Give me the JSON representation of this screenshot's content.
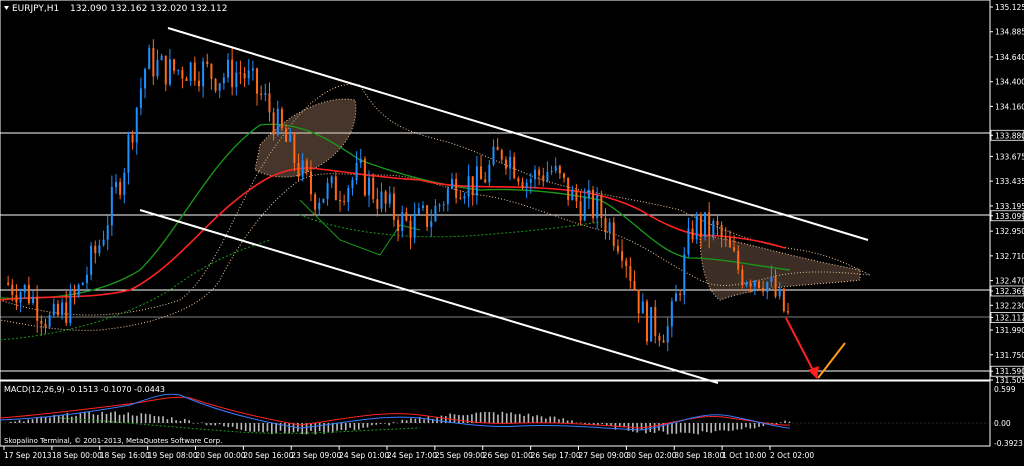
{
  "header": {
    "symbol": "EURJPY,H1",
    "ohlc": "132.090 132.162 132.020 132.112"
  },
  "price_axis": {
    "ticks": [
      "135.125",
      "134.885",
      "134.640",
      "134.400",
      "134.160",
      "133.880",
      "133.675",
      "133.435",
      "133.195",
      "133.099",
      "132.950",
      "132.710",
      "132.470",
      "132.369",
      "132.230",
      "132.112",
      "131.990",
      "131.750",
      "131.590",
      "131.505"
    ],
    "highlighted": [
      "133.880",
      "133.099",
      "132.369",
      "132.112",
      "131.590"
    ]
  },
  "macd": {
    "label": "MACD(12,26,9) -0.1513 -0.1070 -0.0443",
    "ticks": [
      "0.599",
      "0.00",
      "-0.3923"
    ]
  },
  "time_axis": {
    "labels": [
      "17 Sep 2013",
      "18 Sep 00:00",
      "18 Sep 16:00",
      "19 Sep 08:00",
      "20 Sep 00:00",
      "20 Sep 16:00",
      "23 Sep 09:00",
      "24 Sep 01:00",
      "24 Sep 17:00",
      "25 Sep 09:00",
      "26 Sep 01:00",
      "26 Sep 17:00",
      "27 Sep 09:00",
      "30 Sep 02:00",
      "30 Sep 18:00",
      "1 Oct 10:00",
      "2 Oct 02:00"
    ]
  },
  "footer": {
    "copyright": "Skopalino Terminal, © 2001-2013, MetaQuotes Software Corp."
  },
  "colors": {
    "background": "#000000",
    "candle_up": "#1e90ff",
    "candle_down": "#ff6a1a",
    "ma_red": "#ff2222",
    "ma_green": "#1a9a1a",
    "cloud": "#f5c8a0",
    "channel": "#ffffff",
    "arrow_down": "#ff2020",
    "arrow_up": "#ff9a20"
  },
  "chart_data": {
    "type": "candlestick",
    "ylim": [
      131.505,
      135.125
    ],
    "close_path": [
      [
        "17 Sep 2013",
        132.45
      ],
      [
        "18 Sep 00:00",
        132.36
      ],
      [
        "18 Sep 08:00",
        132.05
      ],
      [
        "18 Sep 16:00",
        132.3
      ],
      [
        "19 Sep 00:00",
        132.82
      ],
      [
        "19 Sep 04:00",
        133.55
      ],
      [
        "19 Sep 08:00",
        134.6
      ],
      [
        "19 Sep 16:00",
        134.5
      ],
      [
        "20 Sep 00:00",
        134.55
      ],
      [
        "20 Sep 08:00",
        134.45
      ],
      [
        "20 Sep 16:00",
        134.5
      ],
      [
        "21 Sep 00:00",
        134.2
      ],
      [
        "23 Sep 01:00",
        133.75
      ],
      [
        "23 Sep 09:00",
        133.3
      ],
      [
        "23 Sep 17:00",
        133.35
      ],
      [
        "24 Sep 01:00",
        133.5
      ],
      [
        "24 Sep 09:00",
        133.2
      ],
      [
        "24 Sep 17:00",
        133.0
      ],
      [
        "25 Sep 01:00",
        133.1
      ],
      [
        "25 Sep 09:00",
        133.45
      ],
      [
        "25 Sep 17:00",
        133.4
      ],
      [
        "26 Sep 01:00",
        133.75
      ],
      [
        "26 Sep 09:00",
        133.45
      ],
      [
        "26 Sep 17:00",
        133.55
      ],
      [
        "27 Sep 01:00",
        133.25
      ],
      [
        "27 Sep 09:00",
        133.15
      ],
      [
        "27 Sep 17:00",
        132.85
      ],
      [
        "30 Sep 02:00",
        132.05
      ],
      [
        "30 Sep 10:00",
        132.0
      ],
      [
        "30 Sep 18:00",
        133.0
      ],
      [
        "1 Oct 02:00",
        132.95
      ],
      [
        "1 Oct 10:00",
        132.55
      ],
      [
        "1 Oct 18:00",
        132.5
      ],
      [
        "2 Oct 02:00",
        132.112
      ]
    ],
    "projection": [
      [
        "2 Oct 02:00",
        132.112
      ],
      [
        "2 Oct 08:00",
        131.55
      ],
      [
        "2 Oct 14:00",
        131.85
      ]
    ]
  }
}
